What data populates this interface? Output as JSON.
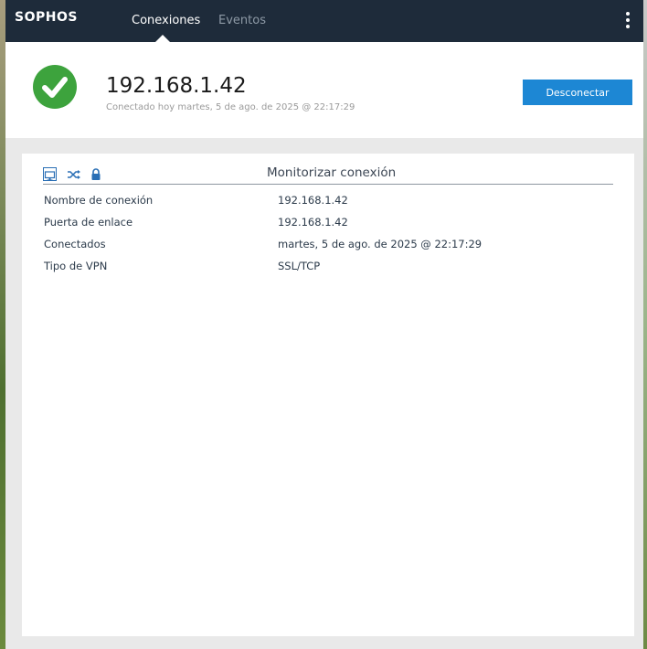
{
  "app": {
    "brand": "SOPHOS",
    "tabs": [
      {
        "label": "Conexiones",
        "active": true
      },
      {
        "label": "Eventos",
        "active": false
      }
    ]
  },
  "connection": {
    "name": "192.168.1.42",
    "status_line": "Conectado hoy martes, 5 de ago. de 2025 @ 22:17:29",
    "disconnect_label": "Desconectar",
    "status_icon": "check-icon"
  },
  "monitor": {
    "title": "Monitorizar conexión",
    "icons": [
      "monitor-icon",
      "shuffle-icon",
      "lock-icon"
    ],
    "rows": [
      {
        "label": "Nombre de conexión",
        "value": "192.168.1.42"
      },
      {
        "label": "Puerta de enlace",
        "value": "192.168.1.42"
      },
      {
        "label": "Conectados",
        "value": "martes, 5 de ago. de 2025 @ 22:17:29"
      },
      {
        "label": "Tipo de VPN",
        "value": "SSL/TCP"
      }
    ]
  },
  "colors": {
    "topbar": "#1e2b3a",
    "accent": "#1d87d4",
    "success": "#3da33d"
  }
}
